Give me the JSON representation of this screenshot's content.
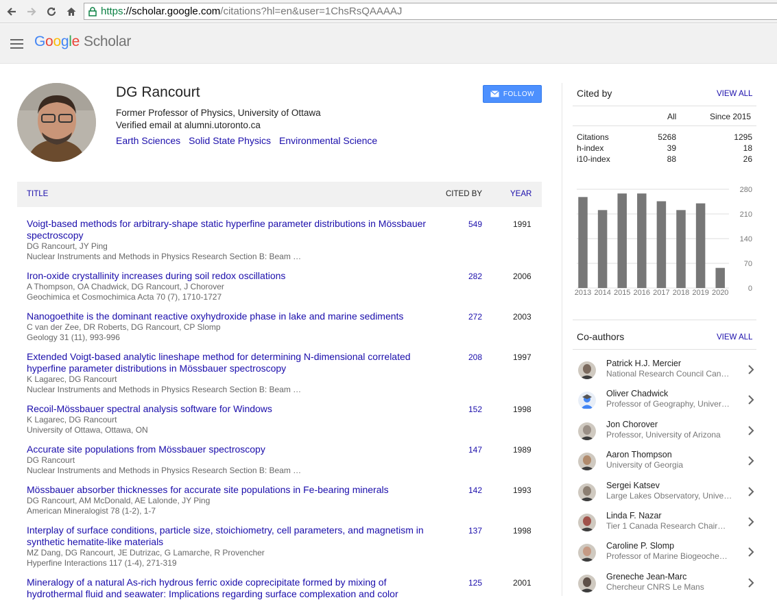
{
  "browser": {
    "url_scheme": "https",
    "url_host": "://scholar.google.com",
    "url_rest": "/citations?hl=en&user=1ChsRsQAAAAJ"
  },
  "header": {
    "logo_letters": [
      "G",
      "o",
      "o",
      "g",
      "l",
      "e"
    ],
    "logo_product": "Scholar"
  },
  "profile": {
    "name": "DG Rancourt",
    "affiliation": "Former Professor of Physics, University of Ottawa",
    "email": "Verified email at alumni.utoronto.ca",
    "topics": [
      "Earth Sciences",
      "Solid State Physics",
      "Environmental Science"
    ],
    "follow_label": "FOLLOW"
  },
  "table": {
    "col_title": "TITLE",
    "col_cited": "CITED BY",
    "col_year": "YEAR"
  },
  "articles": [
    {
      "title": "Voigt-based methods for arbitrary-shape static hyperfine parameter distributions in Mössbauer spectroscopy",
      "authors": "DG Rancourt, JY Ping",
      "venue": "Nuclear Instruments and Methods in Physics Research Section B: Beam …",
      "cited": "549",
      "year": "1991"
    },
    {
      "title": "Iron-oxide crystallinity increases during soil redox oscillations",
      "authors": "A Thompson, OA Chadwick, DG Rancourt, J Chorover",
      "venue": "Geochimica et Cosmochimica Acta 70 (7), 1710-1727",
      "cited": "282",
      "year": "2006"
    },
    {
      "title": "Nanogoethite is the dominant reactive oxyhydroxide phase in lake and marine sediments",
      "authors": "C van der Zee, DR Roberts, DG Rancourt, CP Slomp",
      "venue": "Geology 31 (11), 993-996",
      "cited": "272",
      "year": "2003"
    },
    {
      "title": "Extended Voigt-based analytic lineshape method for determining N-dimensional correlated hyperfine parameter distributions in Mössbauer spectroscopy",
      "authors": "K Lagarec, DG Rancourt",
      "venue": "Nuclear Instruments and Methods in Physics Research Section B: Beam …",
      "cited": "208",
      "year": "1997"
    },
    {
      "title": "Recoil-Mössbauer spectral analysis software for Windows",
      "authors": "K Lagarec, DG Rancourt",
      "venue": "University of Ottawa, Ottawa, ON",
      "cited": "152",
      "year": "1998"
    },
    {
      "title": "Accurate site populations from Mössbauer spectroscopy",
      "authors": "DG Rancourt",
      "venue": "Nuclear Instruments and Methods in Physics Research Section B: Beam …",
      "cited": "147",
      "year": "1989"
    },
    {
      "title": "Mössbauer absorber thicknesses for accurate site populations in Fe-bearing minerals",
      "authors": "DG Rancourt, AM McDonald, AE Lalonde, JY Ping",
      "venue": "American Mineralogist 78 (1-2), 1-7",
      "cited": "142",
      "year": "1993"
    },
    {
      "title": "Interplay of surface conditions, particle size, stoichiometry, cell parameters, and magnetism in synthetic hematite-like materials",
      "authors": "MZ Dang, DG Rancourt, JE Dutrizac, G Lamarche, R Provencher",
      "venue": "Hyperfine Interactions 117 (1-4), 271-319",
      "cited": "137",
      "year": "1998"
    },
    {
      "title": "Mineralogy of a natural As-rich hydrous ferric oxide coprecipitate formed by mixing of hydrothermal fluid and seawater: Implications regarding surface complexation and color",
      "authors": "",
      "venue": "",
      "cited": "125",
      "year": "2001"
    }
  ],
  "cited_by": {
    "title": "Cited by",
    "view_all": "VIEW ALL",
    "col_all": "All",
    "col_since": "Since 2015",
    "rows": [
      {
        "label": "Citations",
        "all": "5268",
        "since": "1295"
      },
      {
        "label": "h-index",
        "all": "39",
        "since": "18"
      },
      {
        "label": "i10-index",
        "all": "88",
        "since": "26"
      }
    ]
  },
  "chart_data": {
    "type": "bar",
    "categories": [
      "2013",
      "2014",
      "2015",
      "2016",
      "2017",
      "2018",
      "2019",
      "2020"
    ],
    "values": [
      258,
      221,
      268,
      268,
      246,
      221,
      240,
      57
    ],
    "ylim": [
      0,
      280
    ],
    "yticks": [
      "280",
      "210",
      "140",
      "70",
      "0"
    ],
    "bar_color": "#777777",
    "grid": true
  },
  "coauthors": {
    "title": "Co-authors",
    "view_all": "VIEW ALL",
    "items": [
      {
        "name": "Patrick H.J. Mercier",
        "aff": "National Research Council Can…",
        "avatar": "photo"
      },
      {
        "name": "Oliver Chadwick",
        "aff": "Professor of Geography, Univer…",
        "avatar": "default-scholar-icon"
      },
      {
        "name": "Jon Chorover",
        "aff": "Professor, University of Arizona",
        "avatar": "photo"
      },
      {
        "name": "Aaron Thompson",
        "aff": "University of Georgia",
        "avatar": "photo"
      },
      {
        "name": "Sergei Katsev",
        "aff": "Large Lakes Observatory, Unive…",
        "avatar": "photo"
      },
      {
        "name": "Linda F. Nazar",
        "aff": "Tier 1 Canada Research Chair…",
        "avatar": "photo"
      },
      {
        "name": "Caroline P. Slomp",
        "aff": "Professor of Marine Biogeoche…",
        "avatar": "photo"
      },
      {
        "name": "Greneche Jean-Marc",
        "aff": "Chercheur CNRS Le Mans",
        "avatar": "photo"
      }
    ]
  }
}
